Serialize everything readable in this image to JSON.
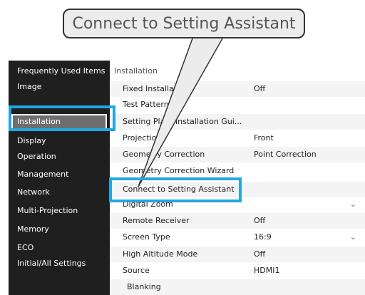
{
  "callout": {
    "text": "Connect to Setting Assistant"
  },
  "sidebar": {
    "items": [
      {
        "label": "Frequently Used Items"
      },
      {
        "label": "Image"
      },
      {
        "label": "Installation"
      },
      {
        "label": "Display"
      },
      {
        "label": "Operation"
      },
      {
        "label": "Management"
      },
      {
        "label": "Network"
      },
      {
        "label": "Multi-Projection"
      },
      {
        "label": "Memory"
      },
      {
        "label": "ECO"
      },
      {
        "label": "Initial/All Settings"
      }
    ],
    "selected": "Installation"
  },
  "main": {
    "header": "Installation",
    "rows": [
      {
        "label": "Fixed Installation",
        "value": "Off"
      },
      {
        "label": "Test Pattern",
        "value": ""
      },
      {
        "label": "Setting Plate Installation Gui...",
        "value": ""
      },
      {
        "label": "Projection",
        "value": "Front"
      },
      {
        "label": "Geometry Correction",
        "value": "Point Correction"
      },
      {
        "label": "Geometry Correction Wizard",
        "value": ""
      },
      {
        "label": "Connect to Setting Assistant",
        "value": ""
      },
      {
        "label": "Digital Zoom",
        "value": "",
        "icon": "chevron-down-icon"
      },
      {
        "label": "Remote Receiver",
        "value": "Off"
      },
      {
        "label": "Screen Type",
        "value": "16:9",
        "icon": "chevron-down-icon"
      },
      {
        "label": "High Altitude Mode",
        "value": "Off"
      },
      {
        "label": "Source",
        "value": "HDMI1"
      },
      {
        "label": "Blanking",
        "value": ""
      }
    ]
  },
  "highlight": {
    "color": "#22a7e0"
  }
}
